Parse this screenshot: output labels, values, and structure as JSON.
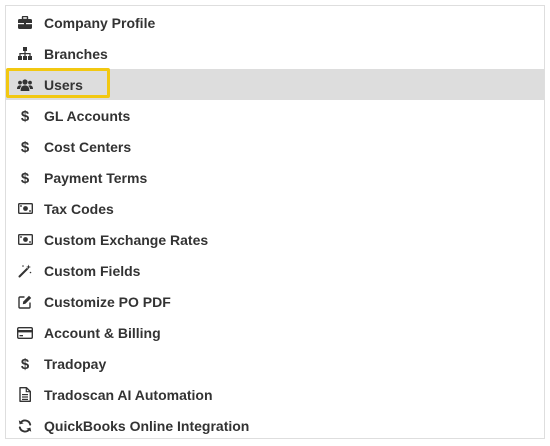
{
  "colors": {
    "active_row_bg": "#dddddd",
    "highlight_border": "#f2c811",
    "text": "#333333",
    "panel_border": "#dedede"
  },
  "menu": {
    "active_item": "users",
    "items": [
      {
        "id": "company-profile",
        "label": "Company Profile",
        "icon": "briefcase-icon"
      },
      {
        "id": "branches",
        "label": "Branches",
        "icon": "sitemap-icon"
      },
      {
        "id": "users",
        "label": "Users",
        "icon": "users-icon"
      },
      {
        "id": "gl-accounts",
        "label": "GL Accounts",
        "icon": "dollar-icon"
      },
      {
        "id": "cost-centers",
        "label": "Cost Centers",
        "icon": "dollar-icon"
      },
      {
        "id": "payment-terms",
        "label": "Payment Terms",
        "icon": "dollar-icon"
      },
      {
        "id": "tax-codes",
        "label": "Tax Codes",
        "icon": "money-bill-icon"
      },
      {
        "id": "custom-exchange-rates",
        "label": "Custom Exchange Rates",
        "icon": "money-bill-icon"
      },
      {
        "id": "custom-fields",
        "label": "Custom Fields",
        "icon": "magic-wand-icon"
      },
      {
        "id": "customize-po-pdf",
        "label": "Customize PO PDF",
        "icon": "edit-icon"
      },
      {
        "id": "account-billing",
        "label": "Account & Billing",
        "icon": "credit-card-icon"
      },
      {
        "id": "tradopay",
        "label": "Tradopay",
        "icon": "dollar-icon"
      },
      {
        "id": "tradoscan-ai-automation",
        "label": "Tradoscan AI Automation",
        "icon": "document-icon"
      },
      {
        "id": "quickbooks-online-integration",
        "label": "QuickBooks Online Integration",
        "icon": "sync-icon"
      }
    ]
  }
}
